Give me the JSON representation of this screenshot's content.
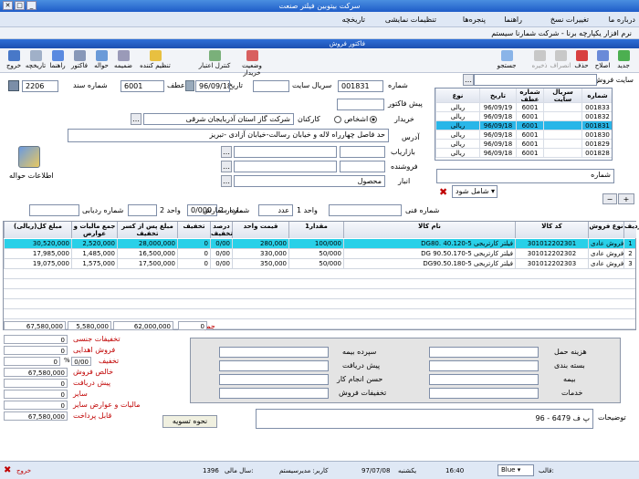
{
  "window": {
    "title": "سرکت بیتوبین ‌فیلتر صنعت"
  },
  "menu": {
    "items": [
      "درباره ما",
      "تغییرات نسخ",
      "راهنما",
      "پنجره‌ها",
      "تنظیمات نمایشی",
      "تاریخچه"
    ],
    "app_caption": "نرم افزار یکپارچه برنا - شرکت شمارنا سیستم"
  },
  "child": {
    "title": "فاکتور فروش"
  },
  "toolbar": {
    "right": [
      "جدید",
      "اصلاح",
      "حذف",
      "انصراف",
      "ذخیره",
      "جستجو"
    ],
    "left": [
      "وضعیت خریدار",
      "کنترل اعتبار",
      "تنظیم کننده",
      "ضمیمه",
      "حواله",
      "فاکتور",
      "راهنما",
      "تاریخچه",
      "خروج"
    ]
  },
  "form": {
    "site_label": "سایت فروش",
    "number_label": "شماره",
    "number": "001831",
    "site_serial_label": "سریال سایت",
    "site_serial": "",
    "date_label": "تاریخ",
    "date": "96/09/18",
    "atf_label": "عطف",
    "atf": "6001",
    "doc_label": "شماره سند",
    "doc": "2206",
    "prefactor_label": "پیش فاکتور",
    "buyer_label": "خریدار",
    "persons_label": "اشخاص",
    "center_label": "کارکنان",
    "buyer_name": "شرکت گاز استان آذربایجان شرقی",
    "address_label": "آدرس",
    "address": "حد فاصل چهارراه لاله و خیابان رسالت-خیابان آزادی -تبریز",
    "marketer_label": "بازاریاب",
    "seller_label": "فروشنده",
    "warehouse_label": "انبار",
    "warehouse": "محصول",
    "hawale_info": "اطلاعات حواله",
    "order_label": "شماره سفارش",
    "tracking_label": "شماره ردیابی",
    "unit2_label": "مقدار 2",
    "unit2": "0/000",
    "unit2b_label": "واحد 2",
    "unit1_label": "واحد 1",
    "unit1": "عدد",
    "fani_label": "شماره فنی"
  },
  "list": {
    "headers": [
      "شماره",
      "سریال سایت",
      "شماره عطف",
      "تاریخ",
      "نوع"
    ],
    "rows": [
      [
        "001833",
        "",
        "6001",
        "96/09/19",
        "ریالی"
      ],
      [
        "001832",
        "",
        "6001",
        "96/09/18",
        "ریالی"
      ],
      [
        "001831",
        "",
        "6001",
        "96/09/18",
        "ریالی"
      ],
      [
        "001830",
        "",
        "6001",
        "96/09/18",
        "ریالی"
      ],
      [
        "001829",
        "",
        "6001",
        "96/09/18",
        "ریالی"
      ],
      [
        "001828",
        "",
        "6001",
        "96/09/18",
        "ریالی"
      ]
    ],
    "selected": 2
  },
  "filter": {
    "number_label": "شماره",
    "include_label": "شامل شود"
  },
  "grid": {
    "headers": [
      "ردیف",
      "نوع فروش",
      "کد کالا",
      "نام کالا",
      "مقدار1",
      "قیمت واحد",
      "درصد تخفیف",
      "تخفیف",
      "مبلغ پس از کسر تخفیف",
      "جمع مالیات و عوارض",
      "مبلغ کل(ریالی)"
    ],
    "rows": [
      [
        "1",
        "فروش عادی",
        "301012202301",
        "فیلتر کارتریجی 5-DG80. 40.120",
        "100/000",
        "280,000",
        "0/00",
        "0",
        "28,000,000",
        "2,520,000",
        "30,520,000"
      ],
      [
        "2",
        "فروش عادی",
        "301012202302",
        "فیلتر کارتریجی 5-DG 90.50.170",
        "50/000",
        "330,000",
        "0/00",
        "0",
        "16,500,000",
        "1,485,000",
        "17,985,000"
      ],
      [
        "3",
        "فروش عادی",
        "301012202303",
        "فیلتر کارتریجی 5-DG90.50.180",
        "50/000",
        "350,000",
        "0/00",
        "0",
        "17,500,000",
        "1,575,000",
        "19,075,000"
      ]
    ],
    "selected": 0
  },
  "totals": {
    "label": "جمع",
    "discount": "0",
    "net": "62,000,000",
    "tax": "5,580,000",
    "total": "67,580,000"
  },
  "summary": [
    [
      "تخفیفات جنسی",
      "0"
    ],
    [
      "فروش اهدایی",
      "0"
    ],
    [
      "تخفیف",
      "0"
    ],
    [
      "خالص فروش",
      "67,580,000"
    ],
    [
      "پیش دریافت",
      "0"
    ],
    [
      "سایر",
      "0"
    ],
    [
      "مالیات و عوارض سایر",
      "0"
    ],
    [
      "قابل پرداخت",
      "67,580,000"
    ]
  ],
  "summary_discount_pct": "0/00",
  "costs": {
    "right": [
      "هزینه حمل",
      "بسته بندی",
      "بیمه",
      "خدمات"
    ],
    "left": [
      "سپرده بیمه",
      "پیش دریافت",
      "حسن انجام کار",
      "تخفیفات فروش"
    ]
  },
  "settle_button": "نحوه تسویه",
  "notes": {
    "label": "توضیحات",
    "value": "پ ف 6479 - 96"
  },
  "status": {
    "exit": "خروج",
    "fiscal_label": "سال مالی:",
    "fiscal": "1396",
    "user": "کاربر: مدیرسیستم",
    "date": "97/07/08",
    "day": "یکشنبه",
    "time": "16:40",
    "skin_label": "قالب:",
    "skin": "Blue"
  }
}
